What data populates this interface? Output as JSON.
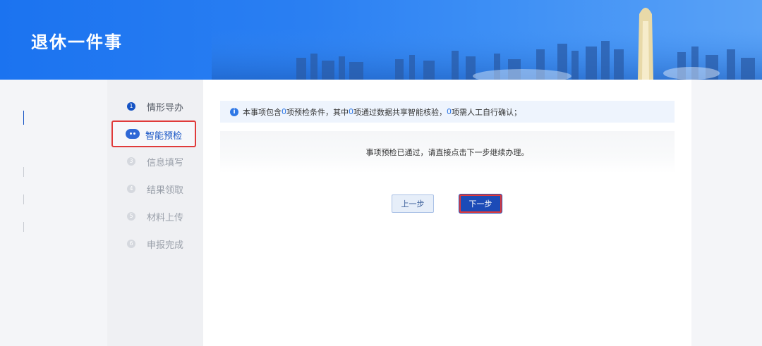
{
  "header": {
    "title": "退休一件事"
  },
  "steps": [
    {
      "number": "1",
      "label": "情形导办",
      "state": "done"
    },
    {
      "number": "",
      "label": "智能预检",
      "state": "current"
    },
    {
      "number": "3",
      "label": "信息填写",
      "state": "pending"
    },
    {
      "number": "4",
      "label": "结果领取",
      "state": "pending"
    },
    {
      "number": "5",
      "label": "材料上传",
      "state": "pending"
    },
    {
      "number": "6",
      "label": "申报完成",
      "state": "pending"
    }
  ],
  "notice": {
    "part1": "本事项包含",
    "count_total": "0",
    "part2": "项预检条件，其中",
    "count_shared": "0",
    "part3": "项通过数据共享智能核验，",
    "count_manual": "0",
    "part4": "项需人工自行确认；"
  },
  "result": {
    "message": "事项预检已通过，请直接点击下一步继续办理。"
  },
  "buttons": {
    "prev_label": "上一步",
    "next_label": "下一步"
  },
  "colors": {
    "accent": "#1553c4",
    "highlight": "#e03a3a",
    "header": "#2a7ff2"
  }
}
